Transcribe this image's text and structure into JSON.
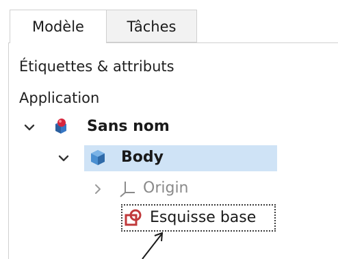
{
  "tabs": [
    {
      "label": "Modèle",
      "active": true
    },
    {
      "label": "Tâches",
      "active": false
    }
  ],
  "panel": {
    "labels_title": "Étiquettes & attributs",
    "application_label": "Application"
  },
  "tree": {
    "document": {
      "label": "Sans nom",
      "expanded": true,
      "icon": "document-icon"
    },
    "body": {
      "label": "Body",
      "expanded": true,
      "selected": true,
      "icon": "body-icon"
    },
    "origin": {
      "label": "Origin",
      "expanded": false,
      "icon": "origin-axes-icon"
    },
    "sketch": {
      "label": "Esquisse base",
      "focused": true,
      "icon": "sketch-icon"
    }
  },
  "colors": {
    "selection": "#cfe3f6",
    "tab_inactive": "#f2f2f2",
    "border": "#cfcfcf",
    "body_icon": "#4a8fd1",
    "sketch_icon": "#c0393b",
    "document_icon_red": "#d7263d",
    "document_icon_blue": "#3777c4"
  }
}
